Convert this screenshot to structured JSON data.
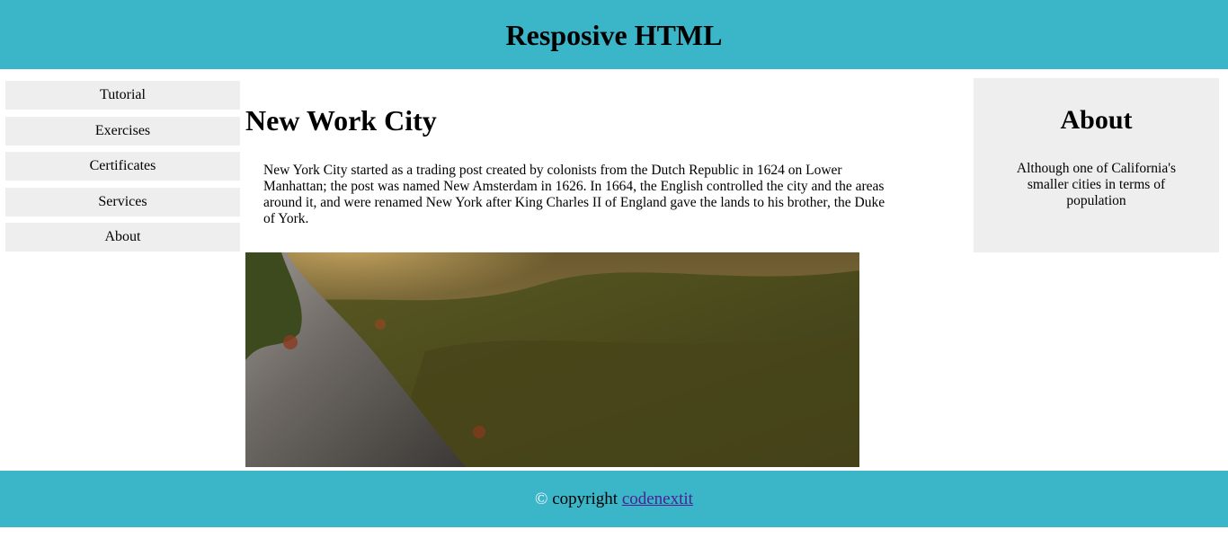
{
  "header": {
    "title": "Resposive HTML"
  },
  "menu": {
    "items": [
      {
        "label": "Tutorial"
      },
      {
        "label": "Exercises"
      },
      {
        "label": "Certificates"
      },
      {
        "label": "Services"
      },
      {
        "label": "About"
      }
    ]
  },
  "main": {
    "heading": "New Work City",
    "paragraph": "New York City started as a trading post created by colonists from the Dutch Republic in 1624 on Lower Manhattan; the post was named New Amsterdam in 1626. In 1664, the English controlled the city and the areas around it, and were renamed New York after King Charles II of England gave the lands to his brother, the Duke of York."
  },
  "aside": {
    "heading": "About",
    "text": "Although one of California's smaller cities in terms of population"
  },
  "footer": {
    "copyright_symbol": "©",
    "copyright_text": "copyright",
    "link_text": "codenextit"
  }
}
